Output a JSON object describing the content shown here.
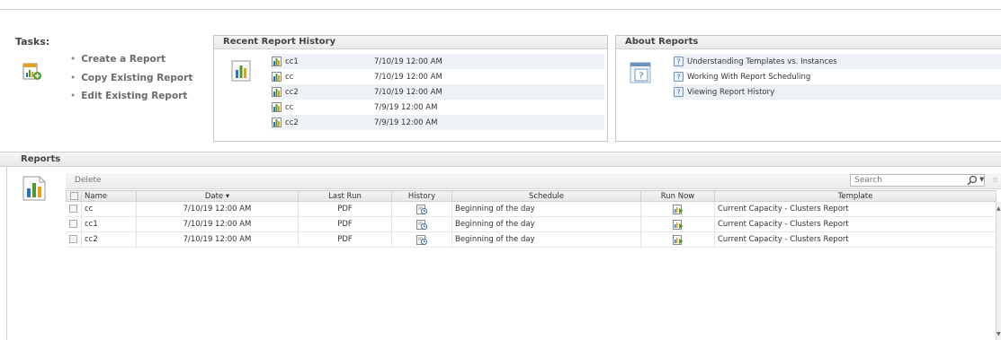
{
  "tasks": {
    "title": "Tasks:",
    "items": [
      {
        "label": "Create a Report"
      },
      {
        "label": "Copy Existing Report"
      },
      {
        "label": "Edit Existing Report"
      }
    ]
  },
  "recent_history": {
    "title": "Recent Report History",
    "rows": [
      {
        "name": "cc1",
        "date": "7/10/19 12:00 AM"
      },
      {
        "name": "cc",
        "date": "7/10/19 12:00 AM"
      },
      {
        "name": "cc2",
        "date": "7/10/19 12:00 AM"
      },
      {
        "name": "cc",
        "date": "7/9/19 12:00 AM"
      },
      {
        "name": "cc2",
        "date": "7/9/19 12:00 AM"
      }
    ]
  },
  "about_reports": {
    "title": "About Reports",
    "links": [
      {
        "label": "Understanding Templates vs. Instances"
      },
      {
        "label": "Working With Report Scheduling"
      },
      {
        "label": "Viewing Report History"
      }
    ]
  },
  "reports": {
    "title": "Reports",
    "toolbar": {
      "delete_label": "Delete",
      "search_placeholder": "Search"
    },
    "columns": {
      "name": "Name",
      "date": "Date",
      "date_sort": "▾",
      "last_run": "Last Run",
      "history": "History",
      "schedule": "Schedule",
      "run_now": "Run Now",
      "template": "Template"
    },
    "rows": [
      {
        "name": "cc",
        "date": "7/10/19 12:00 AM",
        "last_run": "PDF",
        "schedule": "Beginning of the day",
        "template": "Current Capacity - Clusters Report"
      },
      {
        "name": "cc1",
        "date": "7/10/19 12:00 AM",
        "last_run": "PDF",
        "schedule": "Beginning of the day",
        "template": "Current Capacity - Clusters Report"
      },
      {
        "name": "cc2",
        "date": "7/10/19 12:00 AM",
        "last_run": "PDF",
        "schedule": "Beginning of the day",
        "template": "Current Capacity - Clusters Report"
      }
    ]
  },
  "colors": {
    "accent_green": "#4f9a2b",
    "accent_blue": "#2c72b8",
    "accent_orange": "#e3a21a",
    "row_alt": "#eef2f7"
  }
}
